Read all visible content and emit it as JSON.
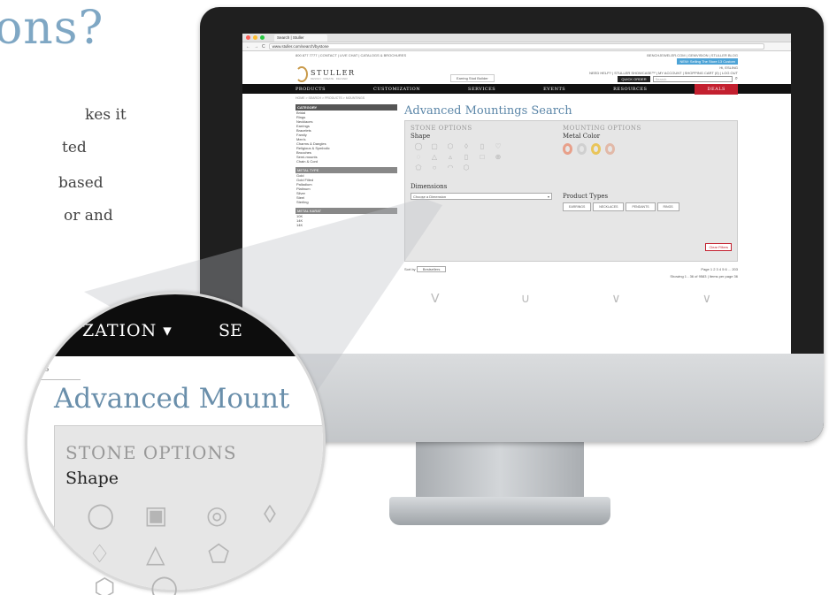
{
  "hero": {
    "title": "ons?",
    "lines": [
      "kes it",
      "ted",
      "based",
      "or and"
    ]
  },
  "browser": {
    "tab_title": "Search | Stuller",
    "url": "www.stuller.com/search/bystone"
  },
  "site": {
    "util_left": "800 877 7777  |  CONTACT  |  LIVE CHAT  |  CATALOGS & BROCHURES",
    "util_right": "BENCHJEWELER.COM  |  GEMVISION  |  STULLER BLOG",
    "banner": "NEW: Selling The Store 13 Custom",
    "logo": "STULLER",
    "logo_sub": "DESIGN · CREATE · DELIVER",
    "featured": "Earring Stud Builder",
    "greeting": "Hi, ESLING",
    "account_links": "NEED HELP?  |  STULLER SHOWCASE™  |  MY ACCOUNT  |  SHOPPING CART (0)  |  LOG OUT",
    "quick_order": "QUICK ORDER",
    "search_placeholder": "Search",
    "nav": [
      "PRODUCTS",
      "CUSTOMIZATION",
      "SERVICES",
      "EVENTS",
      "RESOURCES",
      "DEALS"
    ],
    "breadcrumb": "HOME  >  SEARCH  >  PRODUCTS  >  MOUNTINGS"
  },
  "sidebar": {
    "category_header": "CATEGORY",
    "categories": [
      "Bridal",
      "Rings",
      "Necklaces",
      "Earrings",
      "Bracelets",
      "Family",
      "Men's",
      "Charms & Dangles",
      "Religious & Symbolic",
      "Brooches",
      "Semi-mounts",
      "Chain & Cord"
    ],
    "metal_header": "METAL TYPE",
    "metals": [
      "Gold",
      "Gold Filled",
      "Palladium",
      "Platinum",
      "Silver",
      "Steel",
      "Sterling"
    ],
    "karat_header": "METAL KARAT",
    "karats": [
      "10K",
      "14K",
      "14K"
    ]
  },
  "search": {
    "title": "Advanced Mountings Search",
    "stone_options": "STONE OPTIONS",
    "shape_label": "Shape",
    "mounting_options": "MOUNTING OPTIONS",
    "metal_color_label": "Metal Color",
    "dimensions_label": "Dimensions",
    "dimension_placeholder": "Choose a Dimension",
    "product_types_label": "Product Types",
    "product_types": [
      "EARRINGS",
      "NECKLACES",
      "PENDANTS",
      "RINGS"
    ],
    "clear_filters": "Clear Filters",
    "pagination": "Page  1  2  3  4  5  6 ... 203",
    "sort_label": "Sort by",
    "sort_value": "Bestsellers",
    "showing": "Showing 1 - 36 of 9583  |  Items per page  36"
  },
  "magnifier": {
    "nav_1": "ZATION ▾",
    "nav_2": "SE",
    "side_letter": "s",
    "title": "Advanced Mount",
    "stone_options": "STONE OPTIONS",
    "shape_label": "Shape"
  },
  "colors": {
    "accent_blue": "#5b86a8",
    "deals_red": "#c3202f",
    "nav_black": "#111111",
    "rose_gold": "#e8a08a",
    "white_gold": "#d0d0d0",
    "yellow_gold": "#e9c55a"
  }
}
